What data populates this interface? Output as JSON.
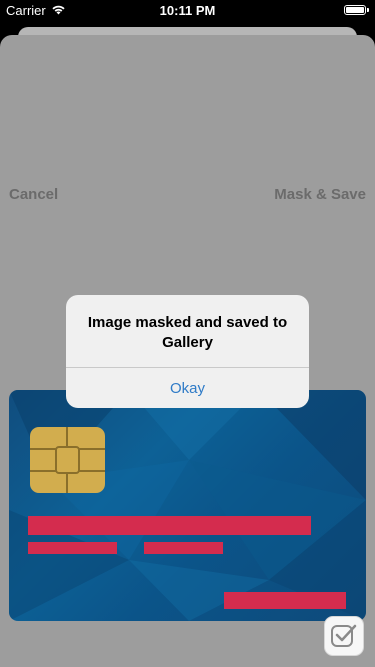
{
  "status_bar": {
    "carrier": "Carrier",
    "time": "10:11 PM"
  },
  "nav": {
    "cancel_label": "Cancel",
    "mask_save_label": "Mask & Save"
  },
  "alert": {
    "message": "Image masked and saved to Gallery",
    "button_label": "Okay"
  },
  "colors": {
    "sheet_background": "#9d9d9d",
    "nav_text": "#6b6b6b",
    "alert_button": "#2f7bc7",
    "card_blue": "#0d6196",
    "chip_gold": "#d2ad4e",
    "mask_bar": "#d42c4e"
  },
  "icons": {
    "wifi": "wifi-icon",
    "battery": "battery-icon",
    "app_badge": "checkmark-badge-icon"
  }
}
